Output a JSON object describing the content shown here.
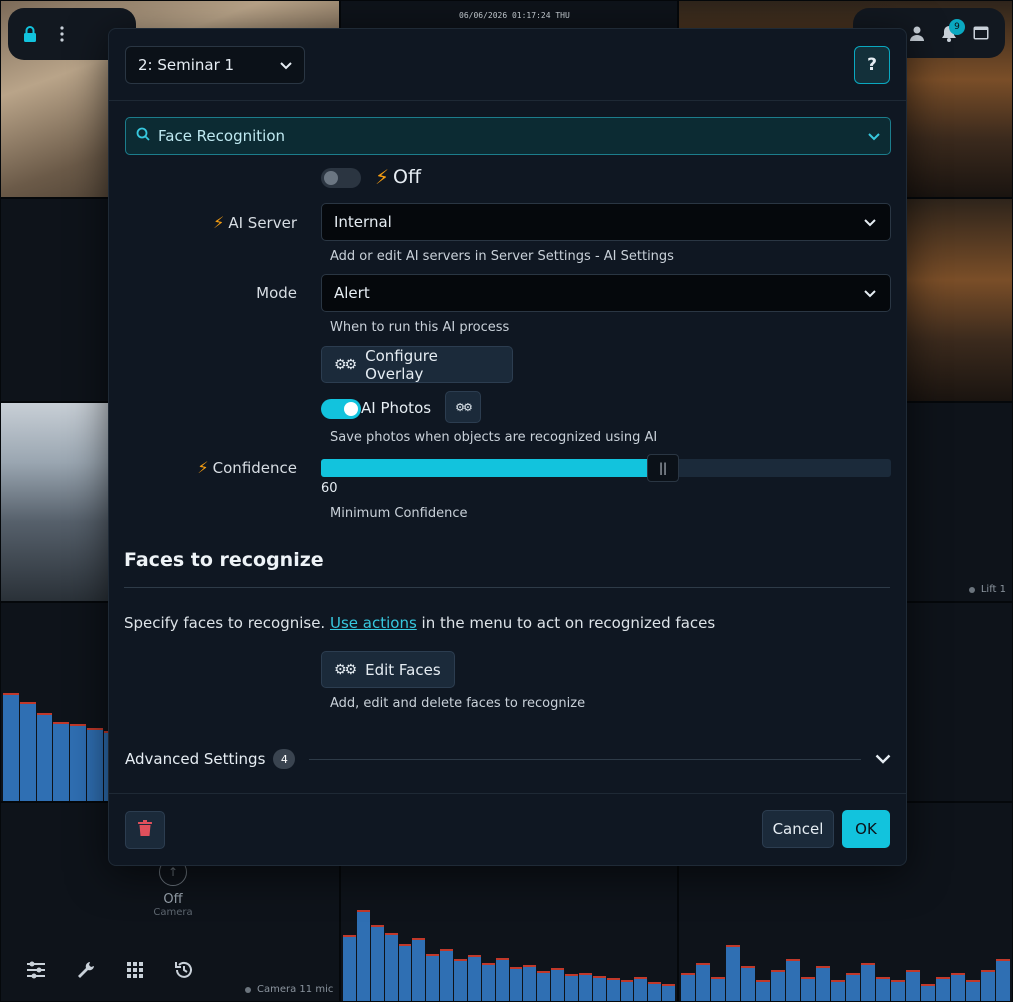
{
  "background": {
    "timestamp": "06/06/2026 01:17:24 THU",
    "notification_count": "9",
    "off_label": "Off",
    "camera_label": "Camera",
    "cam_captions": [
      "Lift 1",
      "Camera 11 mic"
    ]
  },
  "modal": {
    "camera_select": "2: Seminar 1",
    "help_label": "?",
    "section_select": "Face Recognition",
    "enabled_label": "Off",
    "ai_server": {
      "label": "AI Server",
      "value": "Internal",
      "help": "Add or edit AI servers in Server Settings - AI Settings"
    },
    "mode": {
      "label": "Mode",
      "value": "Alert",
      "help": "When to run this AI process"
    },
    "configure_overlay_label": "Configure Overlay",
    "ai_photos": {
      "label": "AI Photos",
      "enabled": true,
      "help": "Save photos when objects are recognized using AI"
    },
    "confidence": {
      "label": "Confidence",
      "value": 60,
      "value_text": "60",
      "help": "Minimum Confidence",
      "thumb_glyph": "||"
    },
    "faces_section": {
      "title": "Faces to recognize",
      "text_before": "Specify faces to recognise. ",
      "link_text": "Use actions",
      "text_after": " in the menu to act on recognized faces",
      "edit_button": "Edit Faces",
      "help": "Add, edit and delete faces to recognize"
    },
    "advanced": {
      "label": "Advanced Settings",
      "count": "4"
    },
    "footer": {
      "cancel": "Cancel",
      "ok": "OK"
    }
  },
  "colors": {
    "accent": "#12c3dd",
    "bolt": "#f39c12",
    "delete": "#e0505c"
  }
}
